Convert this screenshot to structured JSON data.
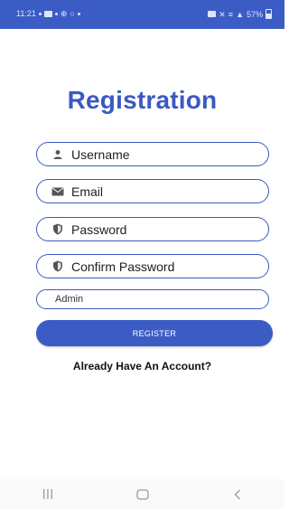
{
  "status_bar": {
    "time": "11:21",
    "battery": "57%"
  },
  "page": {
    "title": "Registration"
  },
  "form": {
    "username": {
      "placeholder": "Username",
      "icon": "person-icon"
    },
    "email": {
      "placeholder": "Email",
      "icon": "envelope-icon"
    },
    "password": {
      "placeholder": "Password",
      "icon": "shield-icon"
    },
    "confirm_password": {
      "placeholder": "Confirm Password",
      "icon": "shield-icon"
    },
    "role": {
      "placeholder": "Admin"
    },
    "register_label": "REGISTER",
    "login_link": "Already Have An Account?"
  },
  "colors": {
    "primary": "#3b5cc4",
    "title": "#3a59c2",
    "text": "#111111"
  },
  "nav_bar": {
    "recents": "recents-icon",
    "home": "home-icon",
    "back": "back-icon"
  }
}
